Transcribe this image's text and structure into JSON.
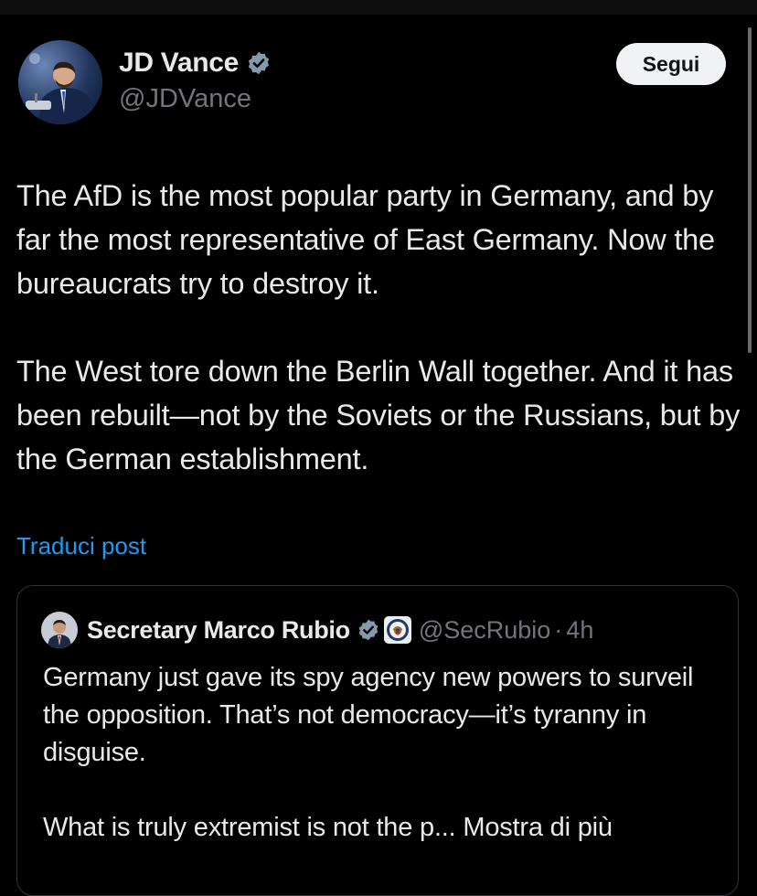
{
  "post": {
    "author": {
      "display_name": "JD Vance",
      "handle": "@JDVance",
      "verified_icon": "verified-badge-icon"
    },
    "follow_label": "Segui",
    "text": "The AfD is the most popular party in Germany, and by far the most representative of East Germany. Now the bureaucrats try to destroy it.\n\nThe West tore down the Berlin Wall together. And it has been rebuilt—not by the Soviets or the Russians, but by the German establishment.",
    "translate_label": "Traduci post"
  },
  "quote": {
    "author": {
      "display_name": "Secretary Marco Rubio",
      "handle": "@SecRubio",
      "time_separator": "·",
      "time": "4h",
      "verified_icon": "verified-badge-icon",
      "affiliation_icon": "state-department-seal-icon"
    },
    "text": "Germany just gave its spy agency new powers to surveil the opposition.  That’s not democracy—it’s tyranny in disguise.\n\nWhat is truly extremist is not the p...",
    "show_more_label": "Mostra di più"
  },
  "colors": {
    "background": "#000000",
    "primary_text": "#e7e9ea",
    "secondary_text": "#71767b",
    "link": "#1d9bf0",
    "verified": "#829aab",
    "border": "#2f3336",
    "follow_button_bg": "#eff3f4"
  }
}
